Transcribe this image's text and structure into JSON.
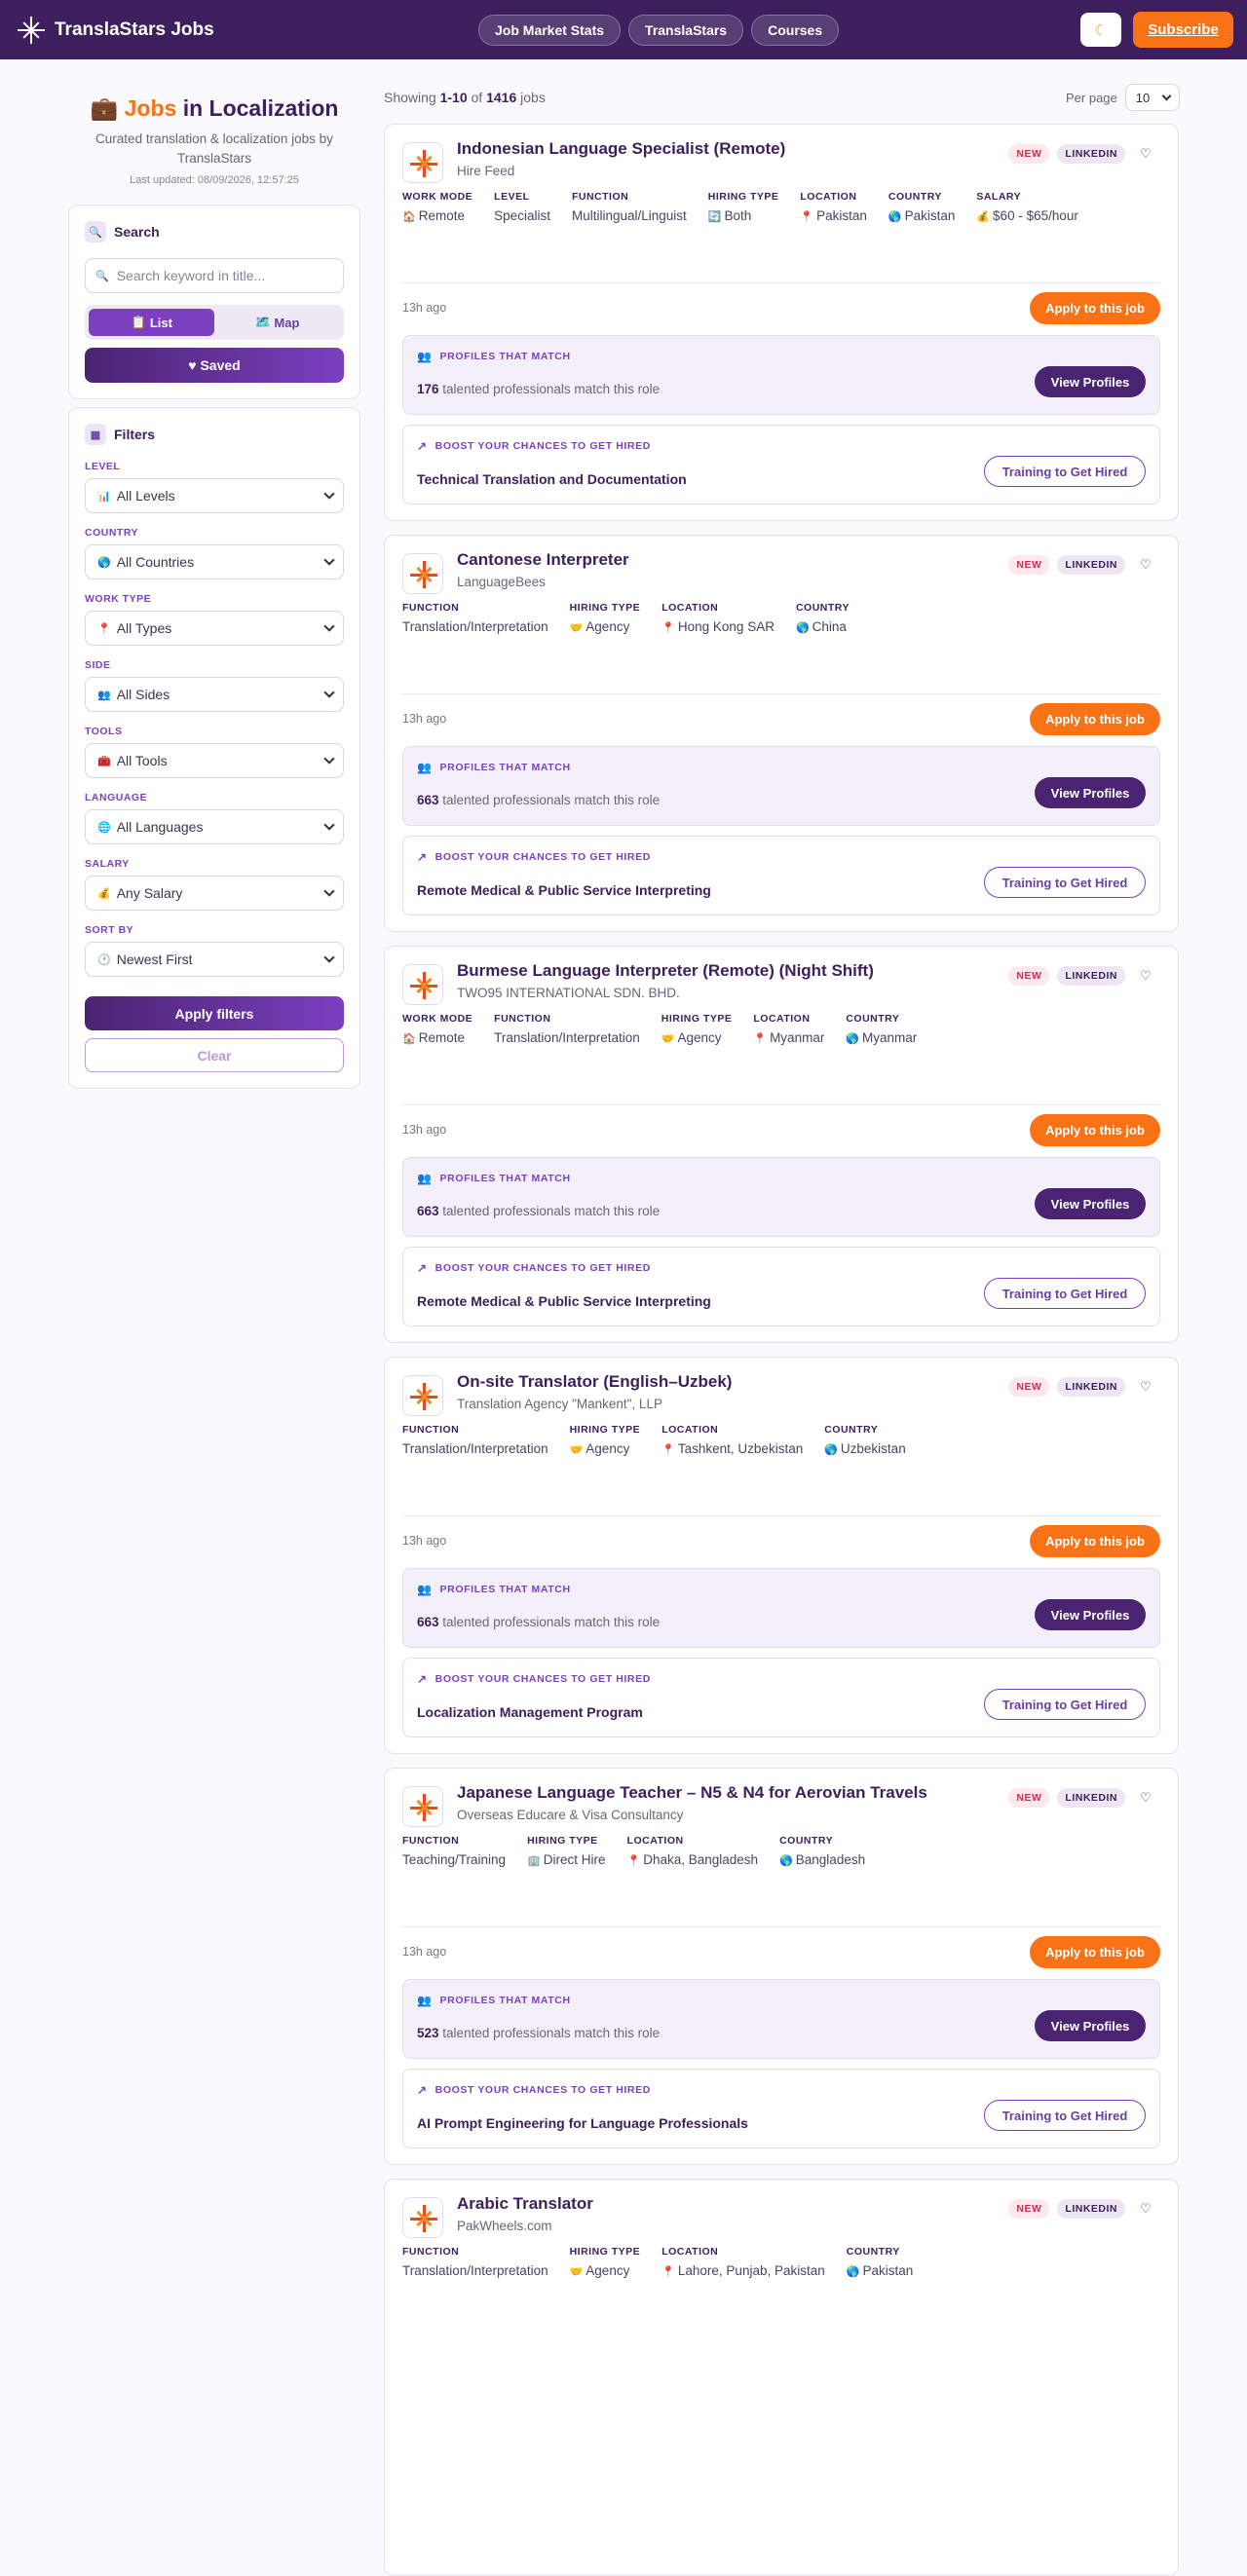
{
  "header": {
    "brand": "TranslaStars Jobs",
    "nav": [
      "Job Market Stats",
      "TranslaStars",
      "Courses"
    ],
    "theme_icon": "moon-icon",
    "subscribe": "Subscribe"
  },
  "sidebar": {
    "title_accent": "Jobs",
    "title_rest": "in Localization",
    "subtitle": "Curated translation & localization jobs by TranslaStars",
    "updated": "Last updated: 08/09/2026, 12:57:25",
    "search": {
      "heading": "Search",
      "placeholder": "Search keyword in title...",
      "list_label": "List",
      "map_label": "Map",
      "saved_label": "♥ Saved"
    },
    "filters": {
      "heading": "Filters",
      "items": [
        {
          "label": "LEVEL",
          "icon": "📊",
          "value": "All Levels"
        },
        {
          "label": "COUNTRY",
          "icon": "🌎",
          "value": "All Countries"
        },
        {
          "label": "WORK TYPE",
          "icon": "📍",
          "value": "All Types"
        },
        {
          "label": "SIDE",
          "icon": "👥",
          "value": "All Sides"
        },
        {
          "label": "TOOLS",
          "icon": "🧰",
          "value": "All Tools"
        },
        {
          "label": "LANGUAGE",
          "icon": "🌐",
          "value": "All Languages"
        },
        {
          "label": "SALARY",
          "icon": "💰",
          "value": "Any Salary"
        },
        {
          "label": "SORT BY",
          "icon": "🕐",
          "value": "Newest First"
        }
      ],
      "apply_label": "Apply filters",
      "clear_label": "Clear"
    }
  },
  "results": {
    "showing_prefix": "Showing",
    "range": "1-10",
    "of": "of",
    "total": "1416",
    "suffix": "jobs",
    "per_page_label": "Per page",
    "per_page_value": "10"
  },
  "labels": {
    "new": "NEW",
    "linkedin": "LINKEDIN",
    "apply": "Apply to this job",
    "profiles_cap": "PROFILES THAT MATCH",
    "profiles_suffix": "talented professionals match this role",
    "view_profiles": "View Profiles",
    "boost_cap": "BOOST YOUR CHANCES TO GET HIRED",
    "training": "Training to Get Hired"
  },
  "jobs": [
    {
      "title": "Indonesian Language Specialist (Remote)",
      "company": "Hire Feed",
      "meta": [
        {
          "label": "WORK MODE",
          "icon": "🏠",
          "value": "Remote"
        },
        {
          "label": "LEVEL",
          "icon": "",
          "value": "Specialist"
        },
        {
          "label": "FUNCTION",
          "icon": "",
          "value": "Multilingual/Linguist"
        },
        {
          "label": "HIRING TYPE",
          "icon": "🔄",
          "value": "Both"
        },
        {
          "label": "LOCATION",
          "icon": "📍",
          "value": "Pakistan"
        },
        {
          "label": "COUNTRY",
          "icon": "🌎",
          "value": "Pakistan"
        },
        {
          "label": "SALARY",
          "icon": "💰",
          "value": "$60 - $65/hour"
        }
      ],
      "age": "13h ago",
      "profiles": "176",
      "course": "Technical Translation and Documentation"
    },
    {
      "title": "Cantonese Interpreter",
      "company": "LanguageBees",
      "meta": [
        {
          "label": "FUNCTION",
          "icon": "",
          "value": "Translation/Interpretation"
        },
        {
          "label": "HIRING TYPE",
          "icon": "🤝",
          "value": "Agency"
        },
        {
          "label": "LOCATION",
          "icon": "📍",
          "value": "Hong Kong SAR"
        },
        {
          "label": "COUNTRY",
          "icon": "🌎",
          "value": "China"
        }
      ],
      "age": "13h ago",
      "profiles": "663",
      "course": "Remote Medical & Public Service Interpreting"
    },
    {
      "title": "Burmese Language Interpreter (Remote) (Night Shift)",
      "company": "TWO95 INTERNATIONAL SDN. BHD.",
      "meta": [
        {
          "label": "WORK MODE",
          "icon": "🏠",
          "value": "Remote"
        },
        {
          "label": "FUNCTION",
          "icon": "",
          "value": "Translation/Interpretation"
        },
        {
          "label": "HIRING TYPE",
          "icon": "🤝",
          "value": "Agency"
        },
        {
          "label": "LOCATION",
          "icon": "📍",
          "value": "Myanmar"
        },
        {
          "label": "COUNTRY",
          "icon": "🌎",
          "value": "Myanmar"
        }
      ],
      "age": "13h ago",
      "profiles": "663",
      "course": "Remote Medical & Public Service Interpreting"
    },
    {
      "title": "On-site Translator (English–Uzbek)",
      "company": "Translation Agency \"Mankent\", LLP",
      "meta": [
        {
          "label": "FUNCTION",
          "icon": "",
          "value": "Translation/Interpretation"
        },
        {
          "label": "HIRING TYPE",
          "icon": "🤝",
          "value": "Agency"
        },
        {
          "label": "LOCATION",
          "icon": "📍",
          "value": "Tashkent, Uzbekistan"
        },
        {
          "label": "COUNTRY",
          "icon": "🌎",
          "value": "Uzbekistan"
        }
      ],
      "age": "13h ago",
      "profiles": "663",
      "course": "Localization Management Program"
    },
    {
      "title": "Japanese Language Teacher – N5 & N4 for Aerovian Travels",
      "company": "Overseas Educare & Visa Consultancy",
      "meta": [
        {
          "label": "FUNCTION",
          "icon": "",
          "value": "Teaching/Training"
        },
        {
          "label": "HIRING TYPE",
          "icon": "🏢",
          "value": "Direct Hire"
        },
        {
          "label": "LOCATION",
          "icon": "📍",
          "value": "Dhaka, Bangladesh"
        },
        {
          "label": "COUNTRY",
          "icon": "🌎",
          "value": "Bangladesh"
        }
      ],
      "age": "13h ago",
      "profiles": "523",
      "course": "AI Prompt Engineering for Language Professionals"
    },
    {
      "title": "Arabic Translator",
      "company": "PakWheels.com",
      "meta": [
        {
          "label": "FUNCTION",
          "icon": "",
          "value": "Translation/Interpretation"
        },
        {
          "label": "HIRING TYPE",
          "icon": "🤝",
          "value": "Agency"
        },
        {
          "label": "LOCATION",
          "icon": "📍",
          "value": "Lahore, Punjab, Pakistan"
        },
        {
          "label": "COUNTRY",
          "icon": "🌎",
          "value": "Pakistan"
        }
      ],
      "age": "",
      "profiles": "",
      "course": ""
    }
  ]
}
